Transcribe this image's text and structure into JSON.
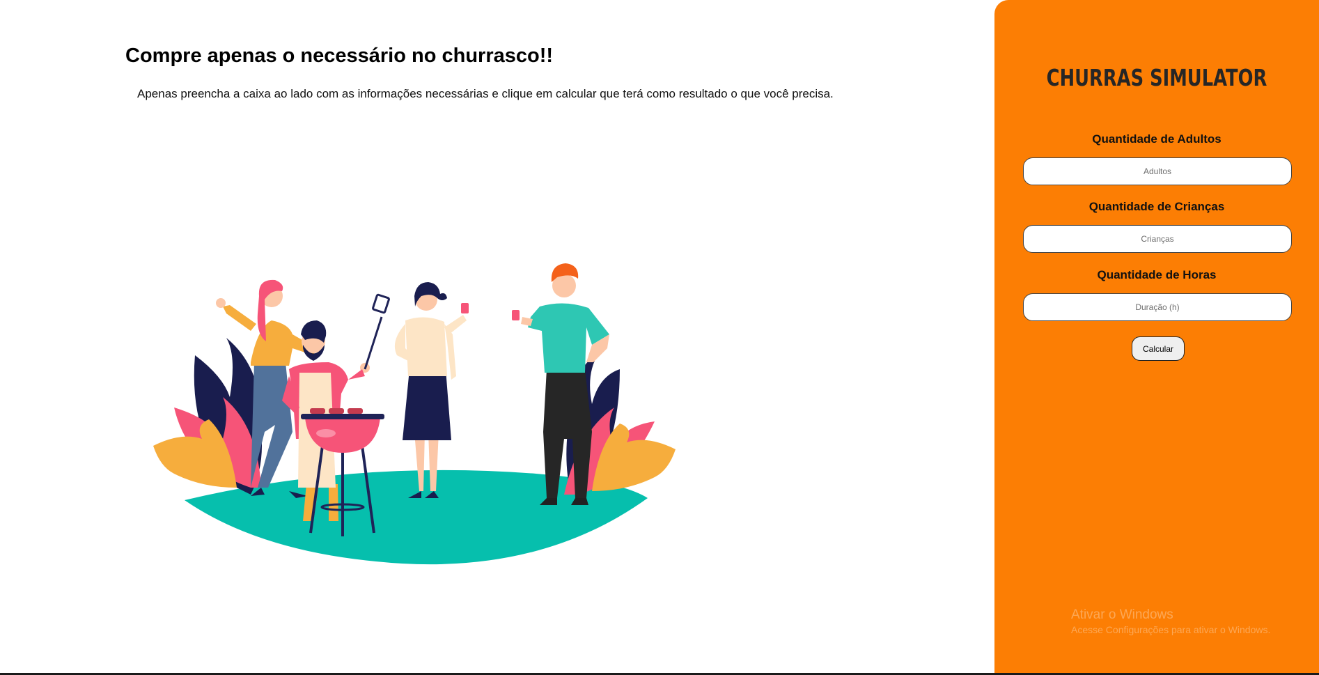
{
  "main": {
    "title": "Compre apenas o necessário no churrasco!!",
    "description": "Apenas preencha a caixa ao lado com as informações necessárias e clique em calcular que terá como resultado o que você precisa."
  },
  "panel": {
    "brand": "CHURRAS SIMULATOR",
    "fields": {
      "adults": {
        "label": "Quantidade de Adultos",
        "placeholder": "Adultos",
        "value": ""
      },
      "children": {
        "label": "Quantidade de Crianças",
        "placeholder": "Crianças",
        "value": ""
      },
      "hours": {
        "label": "Quantidade de Horas",
        "placeholder": "Duração (h)",
        "value": ""
      }
    },
    "calculate_label": "Calcular"
  },
  "watermark": {
    "title": "Ativar o Windows",
    "subtitle": "Acesse Configurações para ativar o Windows."
  },
  "colors": {
    "panel": "#fc7e04",
    "ground": "#06bfad",
    "accent_pink": "#f65478"
  }
}
